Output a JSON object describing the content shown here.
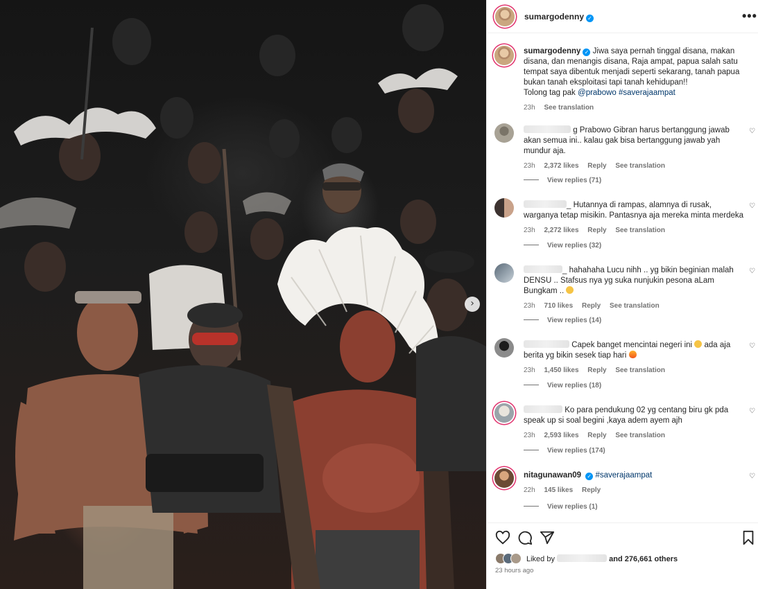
{
  "post": {
    "username": "sumargodenny",
    "more_label": "•••"
  },
  "caption": {
    "username": "sumargodenny",
    "text": "Jiwa saya pernah tinggal disana, makan disana, dan menangis disana, Raja ampat, papua salah satu tempat saya dibentuk menjadi seperti sekarang, tanah papua bukan tanah eksploitasi tapi tanah kehidupan!!",
    "tag_prefix": "Tolong tag pak",
    "mention": "@prabowo",
    "hashtag": "#saverajaampat",
    "time": "23h",
    "translate": "See translation"
  },
  "comments": [
    {
      "text_start": "g Prabowo Gibran harus bertanggung jawab akan semua ini.. kalau gak bisa bertanggung jawab yah mundur aja.",
      "time": "23h",
      "likes": "2,372 likes",
      "reply": "Reply",
      "translate": "See translation",
      "view_replies": "View replies (71)"
    },
    {
      "text_start": "_ Hutannya di rampas, alamnya di rusak, warganya tetap misikin. Pantasnya aja mereka minta merdeka",
      "time": "23h",
      "likes": "2,272 likes",
      "reply": "Reply",
      "translate": "See translation",
      "view_replies": "View replies (32)"
    },
    {
      "text_start": "_ hahahaha Lucu nihh .. yg bikin beginian malah DENSU .. Stafsus nya yg suka nunjukin pesona aLam Bungkam ..",
      "time": "23h",
      "likes": "710 likes",
      "reply": "Reply",
      "translate": "See translation",
      "view_replies": "View replies (14)"
    },
    {
      "text_start": "Capek banget mencintai negeri ini",
      "text_end": "ada aja berita yg bikin sesek tiap hari",
      "time": "23h",
      "likes": "1,450 likes",
      "reply": "Reply",
      "translate": "See translation",
      "view_replies": "View replies (18)"
    },
    {
      "text_start": "Ko para pendukung 02 yg centang biru gk pda speak up si soal begini ,kaya adem ayem ajh",
      "time": "23h",
      "likes": "2,593 likes",
      "reply": "Reply",
      "translate": "See translation",
      "view_replies": "View replies (174)"
    },
    {
      "username": "nitagunawan09",
      "hashtag": "#saverajaampat",
      "time": "22h",
      "likes": "145 likes",
      "reply": "Reply",
      "view_replies": "View replies (1)"
    }
  ],
  "footer": {
    "liked_by": "Liked by",
    "others": "and 276,661 others",
    "time_ago": "23 hours ago"
  },
  "icons": {
    "like": "heart-icon",
    "comment": "comment-icon",
    "share": "share-icon",
    "save": "bookmark-icon",
    "carousel": "chevron-right-icon",
    "verified": "verified-badge-icon"
  },
  "colors": {
    "link": "#00376b",
    "verified": "#0095f6",
    "meta": "#737373"
  }
}
